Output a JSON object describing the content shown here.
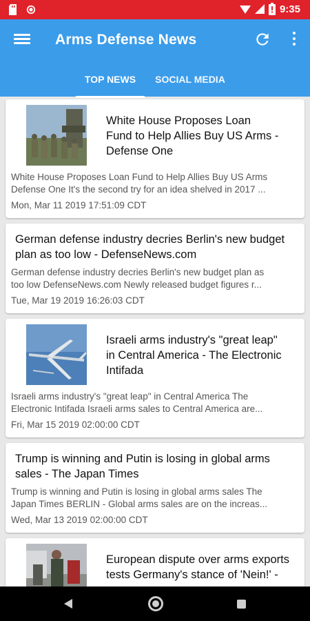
{
  "status_bar": {
    "time": "9:35"
  },
  "app": {
    "title": "Arms Defense News"
  },
  "tabs": [
    {
      "label": "TOP NEWS",
      "active": true
    },
    {
      "label": "SOCIAL MEDIA",
      "active": false
    }
  ],
  "articles": [
    {
      "title_lines": [
        "White House Proposes Loan",
        "Fund to Help Allies Buy US Arms -",
        "Defense One"
      ],
      "snippet_lines": [
        "White House Proposes Loan Fund to Help Allies Buy US Arms",
        "Defense One  It's the second try for an idea shelved in 2017 ..."
      ],
      "date": "Mon, Mar 11 2019 17:51:09 CDT",
      "has_image": true
    },
    {
      "title_lines": [
        "German defense industry decries Berlin's new budget",
        "plan as too low - DefenseNews.com"
      ],
      "snippet_lines": [
        "German defense industry decries Berlin's new budget plan as",
        "too low  DefenseNews.com  Newly released budget figures r..."
      ],
      "date": "Tue, Mar 19 2019 16:26:03 CDT",
      "has_image": false
    },
    {
      "title_lines": [
        "Israeli arms industry's \"great leap\"",
        "in Central America - The Electronic",
        "Intifada"
      ],
      "snippet_lines": [
        "Israeli arms industry's \"great leap\" in Central America  The",
        "Electronic Intifada  Israeli arms sales to Central America are..."
      ],
      "date": "Fri, Mar 15 2019 02:00:00 CDT",
      "has_image": true
    },
    {
      "title_lines": [
        "Trump is winning and Putin is losing in global arms",
        "sales - The Japan Times"
      ],
      "snippet_lines": [
        "Trump is winning and Putin is losing in global arms sales  The",
        "Japan Times  BERLIN - Global arms sales are on the increas..."
      ],
      "date": "Wed, Mar 13 2019 02:00:00 CDT",
      "has_image": false
    },
    {
      "title_lines": [
        "European dispute over arms exports",
        "tests Germany's stance of 'Nein!' -"
      ],
      "snippet_lines": [],
      "date": "",
      "has_image": true
    }
  ]
}
